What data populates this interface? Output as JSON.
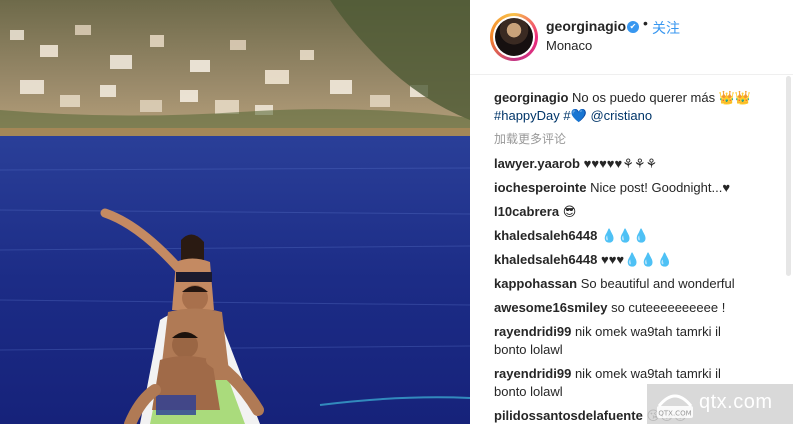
{
  "post": {
    "username": "georginagio",
    "verified_mark": "✔",
    "separator": "•",
    "follow_label": "关注",
    "location": "Monaco"
  },
  "caption": {
    "username": "georginagio",
    "text": "No os puedo querer más 👑👑",
    "hashtag": "#happyDay",
    "hashtag2": "#💙",
    "mention": "@cristiano"
  },
  "load_more_label": "加载更多评论",
  "comments": [
    {
      "user": "lawyer.yaarob",
      "text": "♥♥♥♥♥⚘⚘⚘"
    },
    {
      "user": "iochesperointe",
      "text": "Nice post! Goodnight...♥"
    },
    {
      "user": "l10cabrera",
      "text": "😎"
    },
    {
      "user": "khaledsaleh6448",
      "text": "💧💧💧"
    },
    {
      "user": "khaledsaleh6448",
      "text": "♥♥♥💧💧💧"
    },
    {
      "user": "kappohassan",
      "text": "So beautiful and wonderful"
    },
    {
      "user": "awesome16smiley",
      "text": "so cuteeeeeeeeee !"
    },
    {
      "user": "rayendridi99",
      "text": "nik omek wa9tah tamrki il",
      "text2": "bonto lolawl"
    },
    {
      "user": "rayendridi99",
      "text": "nik omek wa9tah tamrki il",
      "text2": "bonto lolawl"
    },
    {
      "user": "pilidossantosdelafuente",
      "text": "😘😘😘"
    }
  ],
  "watermark": {
    "text": "qtx.com",
    "logo_text": "QTX.COM"
  },
  "colors": {
    "link": "#003569",
    "follow": "#3897f0",
    "muted": "#999999",
    "sea": "#1b2f8a"
  }
}
